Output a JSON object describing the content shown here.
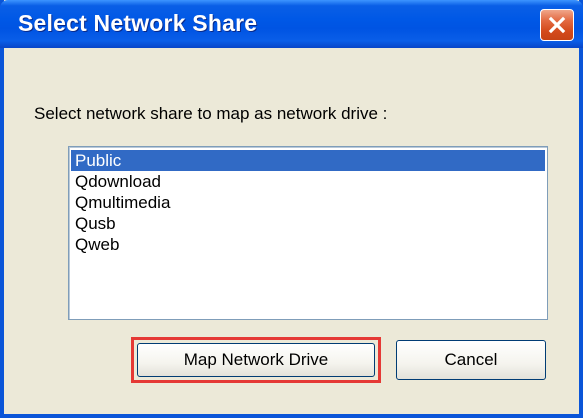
{
  "dialog": {
    "title": "Select Network Share",
    "prompt": "Select network share to map as network drive :",
    "shares": [
      {
        "label": "Public",
        "selected": true
      },
      {
        "label": "Qdownload",
        "selected": false
      },
      {
        "label": "Qmultimedia",
        "selected": false
      },
      {
        "label": "Qusb",
        "selected": false
      },
      {
        "label": "Qweb",
        "selected": false
      }
    ],
    "buttons": {
      "map_label": "Map Network Drive",
      "cancel_label": "Cancel"
    },
    "icons": {
      "close": "close-icon"
    },
    "colors": {
      "titlebar": "#0054e3",
      "selection": "#316ac5",
      "highlight_outline": "#e53935",
      "close_button": "#d44a1c"
    }
  }
}
